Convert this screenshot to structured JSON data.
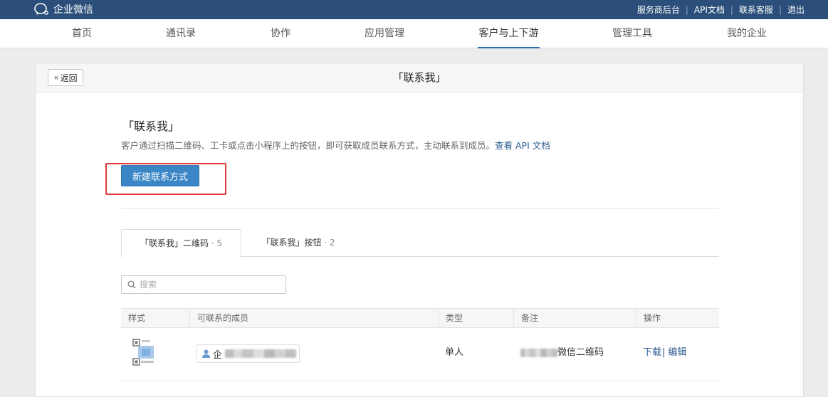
{
  "topbar": {
    "brand": "企业微信",
    "links": [
      "服务商后台",
      "API文档",
      "联系客服",
      "退出"
    ]
  },
  "nav": {
    "items": [
      "首页",
      "通讯录",
      "协作",
      "应用管理",
      "客户与上下游",
      "管理工具",
      "我的企业"
    ],
    "active": "客户与上下游"
  },
  "panel": {
    "back_label": "返回",
    "title": "「联系我」"
  },
  "section": {
    "title": "「联系我」",
    "description": "客户通过扫描二维码、工卡或点击小程序上的按钮，即可获取成员联系方式，主动联系到成员。",
    "api_link": "查看 API 文档",
    "new_button": "新建联系方式"
  },
  "tabs": [
    {
      "label": "「联系我」二维码",
      "count": "· 5"
    },
    {
      "label": "「联系我」按钮",
      "count": "· 2"
    }
  ],
  "search": {
    "placeholder": "搜索"
  },
  "table": {
    "headers": [
      "样式",
      "可联系的成员",
      "类型",
      "备注",
      "操作"
    ],
    "rows": [
      {
        "member_prefix": "企",
        "type": "单人",
        "remark_suffix": "微信二维码",
        "download": "下载",
        "edit": "编辑"
      }
    ]
  },
  "colors": {
    "topbar": "#2b4f7a",
    "primary_button": "#3b86c6",
    "highlight": "#e03a3a",
    "link": "#2b5b8f"
  }
}
